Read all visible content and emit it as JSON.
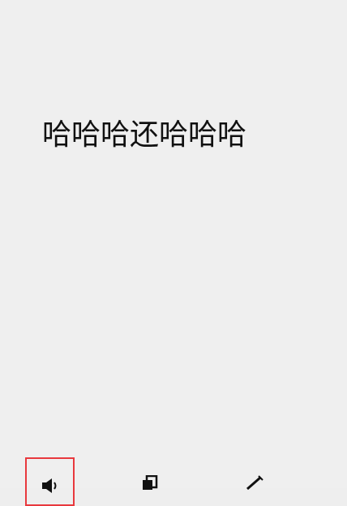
{
  "message": {
    "text": "哈哈哈还哈哈哈"
  },
  "toolbar": {
    "buttons": [
      {
        "icon": "speaker-icon",
        "selected": true
      },
      {
        "icon": "copy-icon",
        "selected": false
      },
      {
        "icon": "edit-pen-icon",
        "selected": false
      }
    ],
    "highlight_color": "#e8383d"
  }
}
